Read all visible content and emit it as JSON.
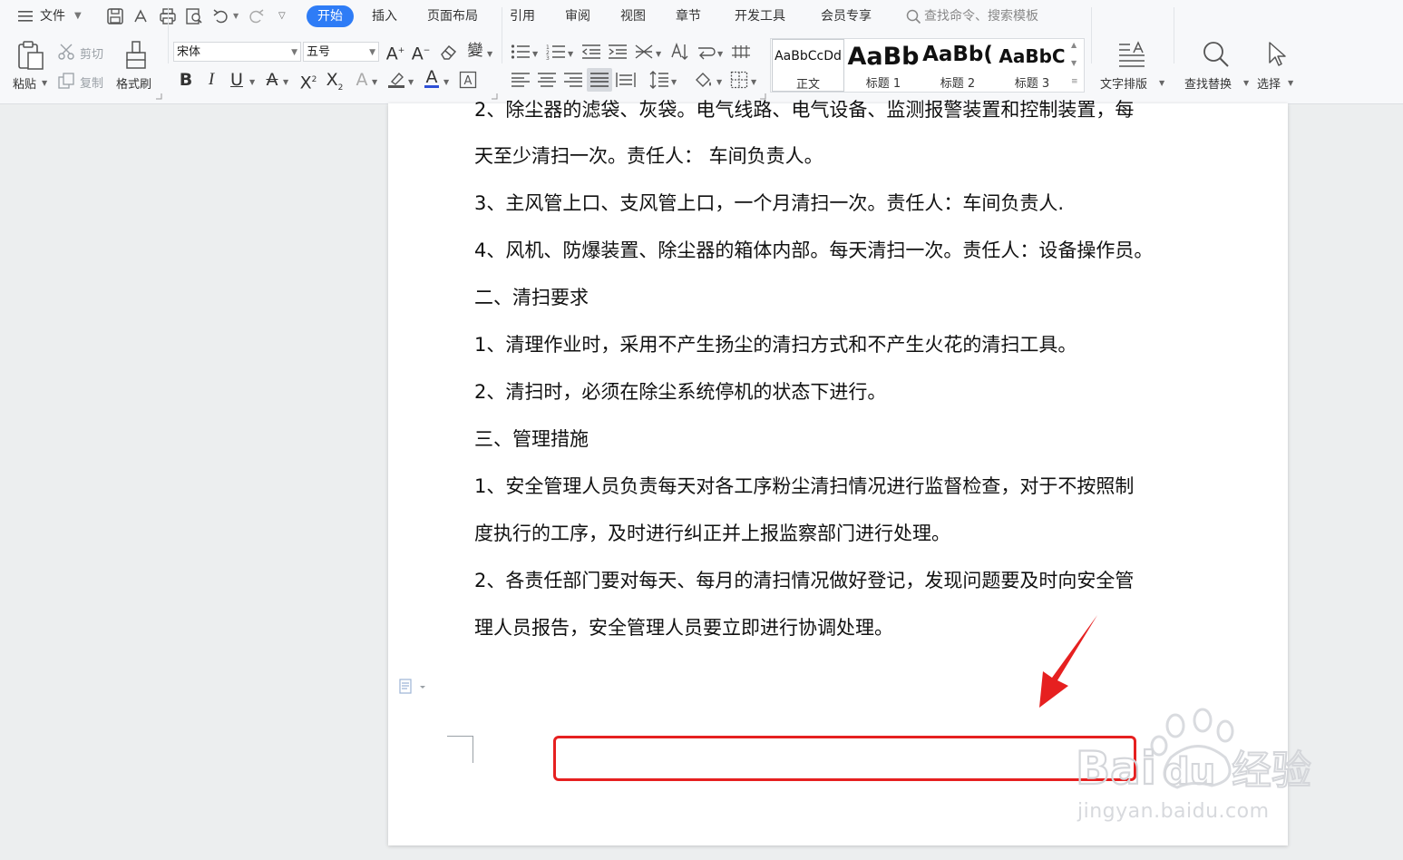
{
  "app": {
    "menu": {
      "file_label": "文件"
    },
    "tabs": [
      {
        "label": "开始",
        "active": true
      },
      {
        "label": "插入"
      },
      {
        "label": "页面布局"
      },
      {
        "label": "引用"
      },
      {
        "label": "审阅"
      },
      {
        "label": "视图"
      },
      {
        "label": "章节"
      },
      {
        "label": "开发工具"
      },
      {
        "label": "会员专享"
      }
    ],
    "search": {
      "placeholder": "查找命令、搜索模板"
    }
  },
  "ribbon": {
    "paste_label": "粘贴",
    "cut_label": "剪切",
    "copy_label": "复制",
    "format_painter_label": "格式刷",
    "font_name": "宋体",
    "font_size": "五号",
    "styles": [
      {
        "sample": "AaBbCcDd",
        "name": "正文"
      },
      {
        "sample": "AaBb",
        "name": "标题 1"
      },
      {
        "sample": "AaBb(",
        "name": "标题 2"
      },
      {
        "sample": "AaBbC",
        "name": "标题 3"
      }
    ],
    "text_layout_label": "文字排版",
    "find_replace_label": "查找替换",
    "select_label": "选择"
  },
  "document": {
    "lines": [
      "2、除尘器的滤袋、灰袋。电气线路、电气设备、监测报警装置和控制装置，每",
      "天至少清扫一次。责任人：  车间负责人。",
      "3、主风管上口、支风管上口，一个月清扫一次。责任人：车间负责人.",
      "4、风机、防爆装置、除尘器的箱体内部。每天清扫一次。责任人：设备操作员。",
      "二、清扫要求",
      "1、清理作业时，采用不产生扬尘的清扫方式和不产生火花的清扫工具。",
      "2、清扫时，必须在除尘系统停机的状态下进行。",
      "三、管理措施",
      "1、安全管理人员负责每天对各工序粉尘清扫情况进行监督检查，对于不按照制",
      "度执行的工序，及时进行纠正并上报监察部门进行处理。",
      "2、各责任部门要对每天、每月的清扫情况做好登记，发现问题要及时向安全管",
      "理人员报告，安全管理人员要立即进行协调处理。"
    ]
  },
  "annotation": {
    "highlight_color": "#e62020"
  },
  "watermark": {
    "text": "Baidu经验",
    "url": "jingyan.baidu.com"
  },
  "colors": {
    "accent": "#2e7cf6"
  }
}
